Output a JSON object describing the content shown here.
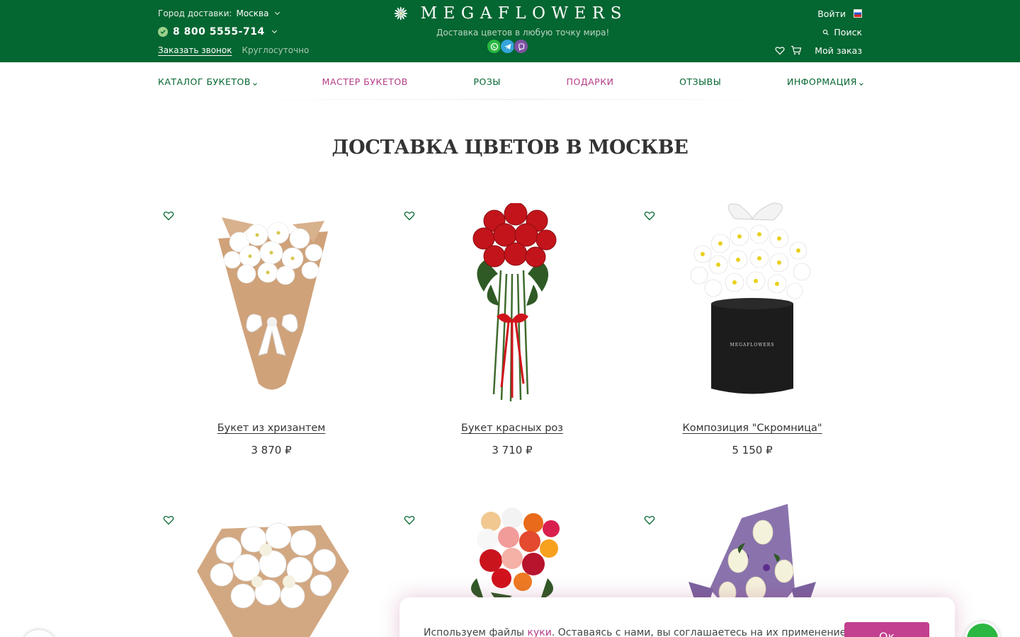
{
  "header": {
    "city_label": "Город доставки:",
    "city_value": "Москва",
    "phone": "8 800 5555-714",
    "callback": "Заказать звонок",
    "hours": "Круглосуточно",
    "logo": "MEGAFLOWERS",
    "tagline": "Доставка цветов в любую точку мира!",
    "login": "Войти",
    "search": "Поиск",
    "my_order": "Мой заказ"
  },
  "nav": [
    {
      "label": "КАТАЛОГ БУКЕТОВ",
      "dropdown": true
    },
    {
      "label": "МАСТЕР БУКЕТОВ"
    },
    {
      "label": "РОЗЫ"
    },
    {
      "label": "ПОДАРКИ"
    },
    {
      "label": "ОТЗЫВЫ"
    },
    {
      "label": "ИНФОРМАЦИЯ",
      "dropdown": true
    }
  ],
  "page_title": "ДОСТАВКА ЦВЕТОВ В МОСКВЕ",
  "products": [
    {
      "name": "Букет из хризантем",
      "price": "3 870 ₽",
      "image": "chrysanthemum-bouquet"
    },
    {
      "name": "Букет красных роз",
      "price": "3 710 ₽",
      "image": "red-roses-bouquet"
    },
    {
      "name": "Композиция \"Скромница\"",
      "price": "5 150 ₽",
      "image": "daisy-hatbox"
    },
    {
      "name": "",
      "price": "",
      "image": "white-mixed-bouquet"
    },
    {
      "name": "",
      "price": "",
      "image": "mixed-roses-bouquet"
    },
    {
      "name": "",
      "price": "",
      "image": "white-roses-purple-wrap"
    }
  ],
  "cookie": {
    "text_before": "Используем файлы ",
    "link": "куки",
    "text_after": ". Оставаясь с нами, вы соглашаетесь на их применение.",
    "button": "Ок"
  },
  "colors": {
    "header_bg": "#046631",
    "accent_pink": "#b33d87",
    "button_pink": "#c2408f"
  }
}
